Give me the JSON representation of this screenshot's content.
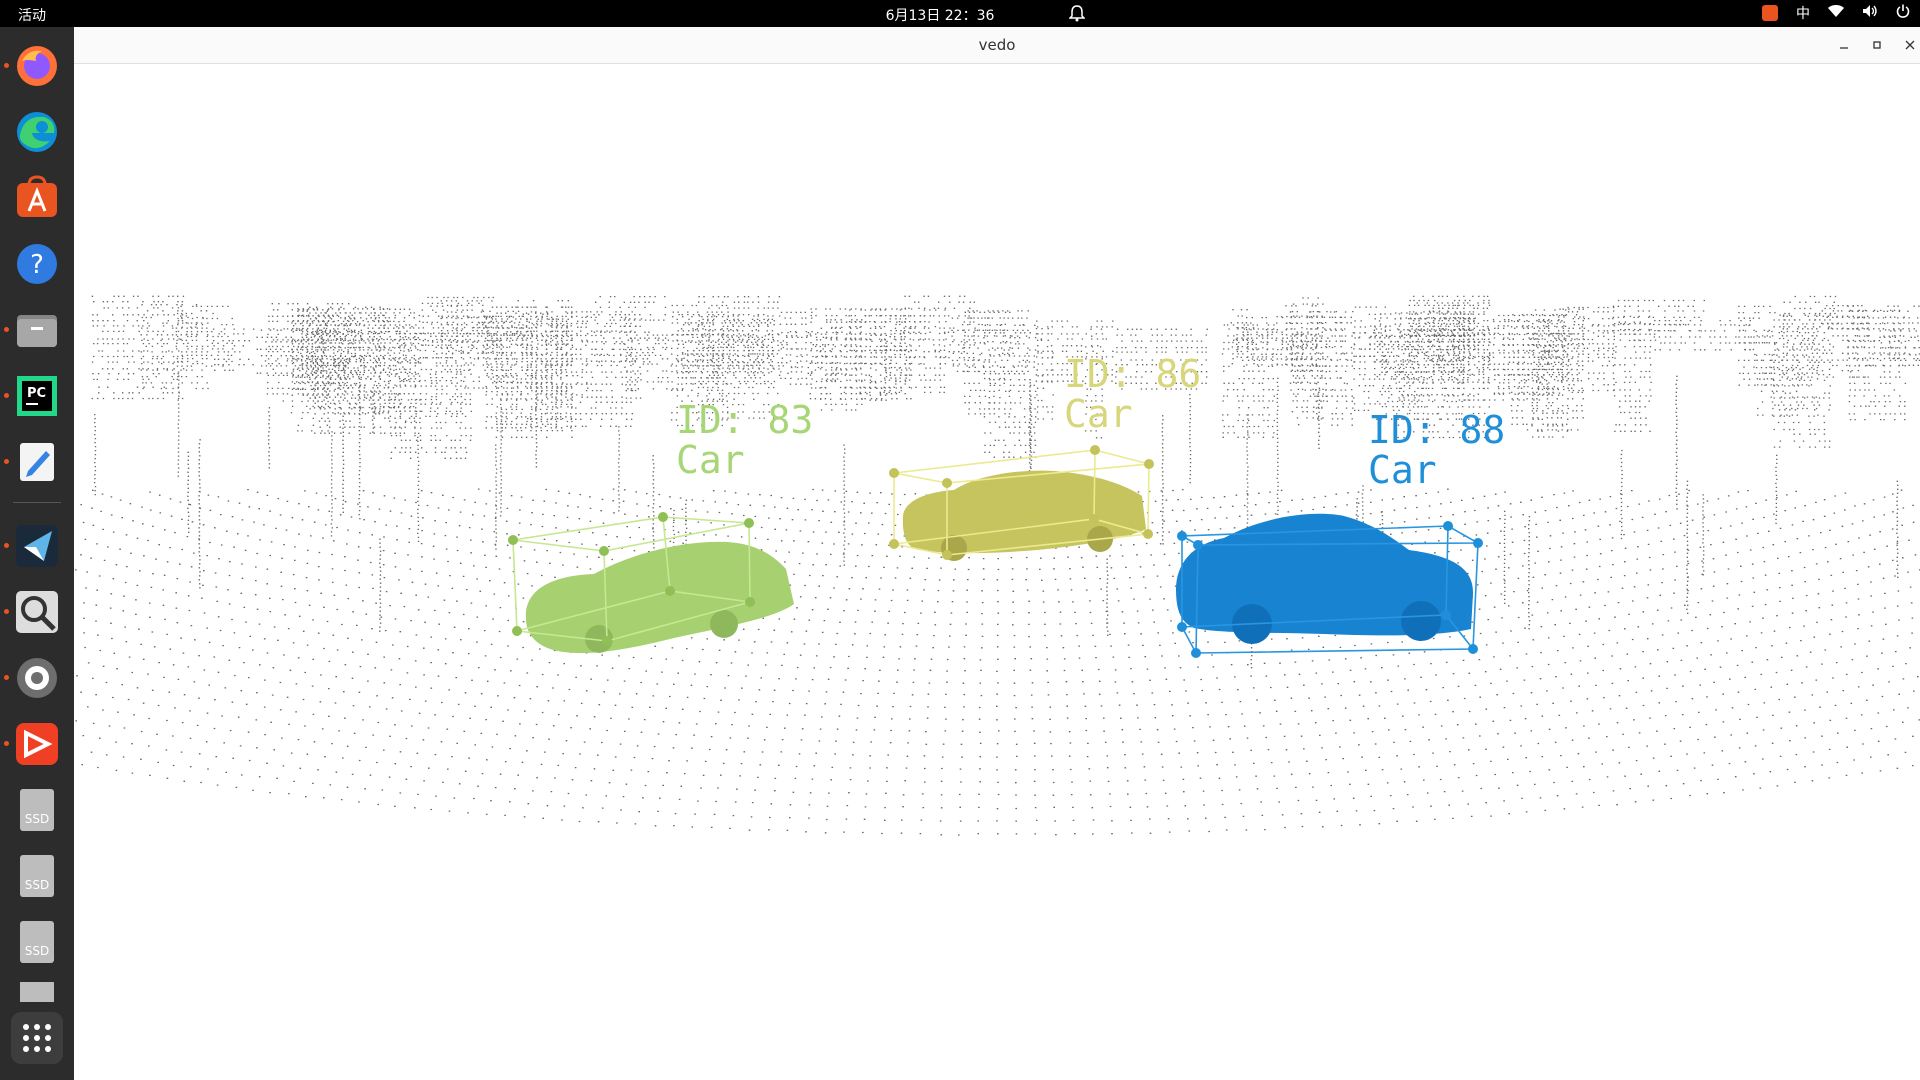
{
  "topbar": {
    "activities": "活动",
    "clock": "6月13日  22：36",
    "input_method": "中"
  },
  "window": {
    "title": "vedo"
  },
  "dock": {
    "items": [
      {
        "name": "firefox",
        "running": true
      },
      {
        "name": "edge",
        "running": false
      },
      {
        "name": "app-center",
        "running": false
      },
      {
        "name": "help",
        "running": false
      },
      {
        "name": "files",
        "running": true
      },
      {
        "name": "pycharm",
        "running": true
      },
      {
        "name": "text-editor",
        "running": true
      },
      {
        "name": "kite",
        "running": true
      },
      {
        "name": "image-search",
        "running": true
      },
      {
        "name": "settings",
        "running": true
      },
      {
        "name": "sunlogin",
        "running": true
      },
      {
        "name": "ssd-drive-1",
        "running": false
      },
      {
        "name": "ssd-drive-2",
        "running": false
      },
      {
        "name": "ssd-drive-3",
        "running": false
      },
      {
        "name": "drive-4",
        "running": false
      }
    ],
    "ssd_label": "SSD",
    "pycharm_label": "PC"
  },
  "objects": [
    {
      "id_text": "ID: 83",
      "class_text": "Car",
      "color": "#a7d676"
    },
    {
      "id_text": "ID: 86",
      "class_text": "Car",
      "color": "#d8d67a"
    },
    {
      "id_text": "ID: 88",
      "class_text": "Car",
      "color": "#1e8fd8"
    }
  ]
}
